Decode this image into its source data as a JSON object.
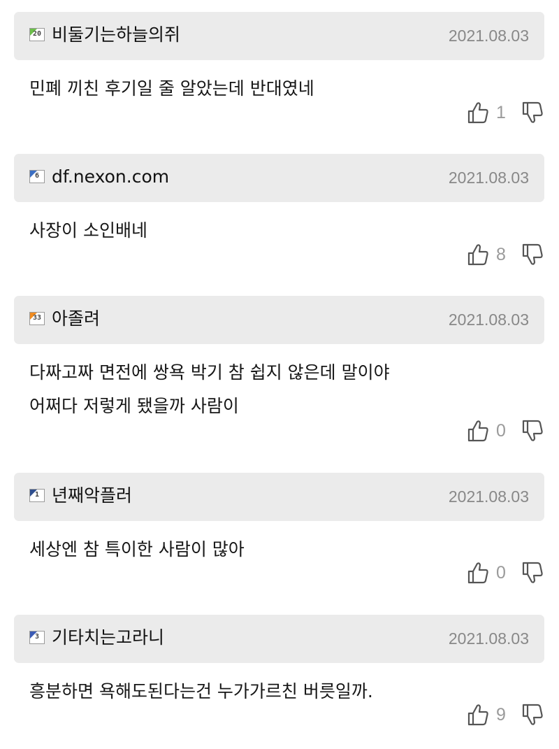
{
  "comments": [
    {
      "level": "20",
      "level_color": "#6cc04a",
      "nickname": "비둘기는하늘의쥐",
      "date": "2021.08.03",
      "lines": [
        "민폐 끼친 후기일 줄 알았는데 반대였네"
      ],
      "likes": "1"
    },
    {
      "level": "6",
      "level_color": "#3b6fc4",
      "nickname": "df.nexon.com",
      "date": "2021.08.03",
      "lines": [
        "사장이 소인배네"
      ],
      "likes": "8"
    },
    {
      "level": "33",
      "level_color": "#f28c1f",
      "nickname": "아졸려",
      "date": "2021.08.03",
      "lines": [
        "다짜고짜 면전에 쌍욕 박기 참 쉽지 않은데 말이야",
        "어쩌다 저렇게 됐을까 사람이"
      ],
      "likes": "0"
    },
    {
      "level": "1",
      "level_color": "#2f4f8f",
      "nickname": "년째악플러",
      "date": "2021.08.03",
      "lines": [
        "세상엔 참 특이한 사람이 많아"
      ],
      "likes": "0"
    },
    {
      "level": "3",
      "level_color": "#3b5bb5",
      "nickname": "기타치는고라니",
      "date": "2021.08.03",
      "lines": [
        "흥분하면 욕해도된다는건 누가가르친 버릇일까."
      ],
      "likes": "9"
    }
  ],
  "icons": {
    "like": "thumbs-up-icon",
    "dislike": "thumbs-down-icon"
  }
}
